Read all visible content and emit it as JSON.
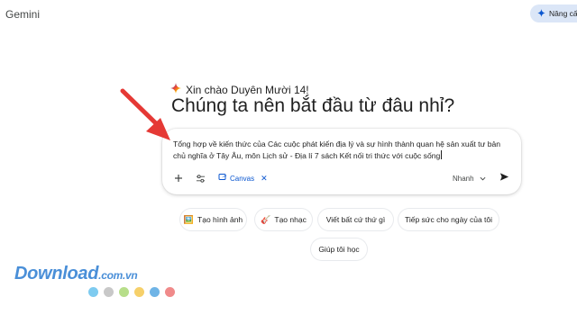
{
  "header": {
    "app_title": "Gemini",
    "upgrade_label": "Nâng cấ"
  },
  "greeting": {
    "hello": "Xin chào Duyên Mười 14!",
    "headline": "Chúng ta nên bắt đầu từ đâu nhỉ?"
  },
  "prompt": {
    "text": "Tổng hợp về kiến thức của Các cuộc phát kiến địa lý và sự hình thành quan hệ sản xuất tư bản chủ nghĩa ở Tây Âu, môn Lịch sử - Địa lí 7 sách Kết nối tri thức với cuộc sống",
    "canvas_label": "Canvas",
    "model_label": "Nhanh",
    "icons": [
      "plus-icon",
      "tools-icon",
      "canvas-icon",
      "close-icon",
      "chevron-down-icon",
      "send-icon"
    ]
  },
  "suggestions": [
    {
      "label": "Tạo hình ảnh",
      "icon": "🖼️"
    },
    {
      "label": "Tạo nhạc",
      "icon": "🎸"
    },
    {
      "label": "Viết bất cứ thứ gì",
      "icon": ""
    },
    {
      "label": "Tiếp sức cho ngày của tôi",
      "icon": ""
    },
    {
      "label": "Giúp tôi học",
      "icon": ""
    }
  ],
  "watermark": {
    "brand": "Download",
    "suffix": ".com.vn",
    "dot_colors": [
      "#7ecbf0",
      "#c8c8c8",
      "#b7de8a",
      "#f6d06a",
      "#6fb4e6",
      "#f08a8a"
    ]
  },
  "colors": {
    "accent": "#0b57d0",
    "annotation_arrow": "#e53935",
    "upgrade_bg": "#dbe6f7"
  }
}
